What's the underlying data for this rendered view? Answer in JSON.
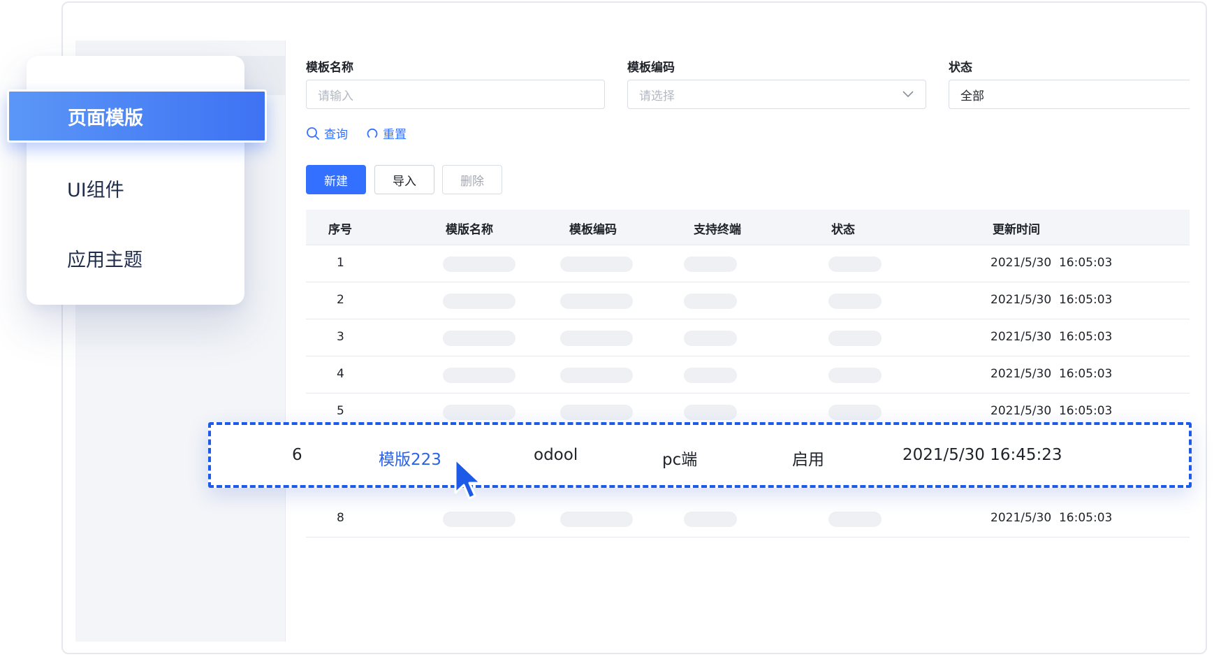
{
  "sidebar": {
    "items": [
      {
        "label": "页面模版",
        "active": true
      },
      {
        "label": "UI组件",
        "active": false
      },
      {
        "label": "应用主题",
        "active": false
      }
    ]
  },
  "filters": {
    "name": {
      "label": "模板名称",
      "placeholder": "请输入"
    },
    "code": {
      "label": "模板编码",
      "placeholder": "请选择"
    },
    "status": {
      "label": "状态",
      "value": "全部"
    }
  },
  "actions": {
    "query": "查询",
    "reset": "重置",
    "new": "新建",
    "import": "导入",
    "delete": "删除"
  },
  "table": {
    "columns": [
      "序号",
      "模版名称",
      "模板编码",
      "支持终端",
      "状态",
      "更新时间"
    ],
    "rows": [
      {
        "index": "1",
        "updated": "2021/5/30  16:05:03"
      },
      {
        "index": "2",
        "updated": "2021/5/30  16:05:03"
      },
      {
        "index": "3",
        "updated": "2021/5/30  16:05:03"
      },
      {
        "index": "4",
        "updated": "2021/5/30  16:05:03"
      },
      {
        "index": "5",
        "updated": "2021/5/30  16:05:03"
      },
      {
        "index": "8",
        "updated": "2021/5/30  16:05:03"
      }
    ],
    "highlighted": {
      "index": "6",
      "name": "模版223",
      "code": "odool",
      "terminal": "pc端",
      "status": "启用",
      "updated": "2021/5/30 16:45:23"
    }
  },
  "colors": {
    "accent": "#3370ff",
    "highlight_border": "#1d5ae8",
    "menu_gradient_start": "#5b97f7",
    "menu_gradient_end": "#3e72f3"
  },
  "icons": [
    "search-icon",
    "reset-icon",
    "chevron-down-icon",
    "cursor-pointer-icon"
  ]
}
